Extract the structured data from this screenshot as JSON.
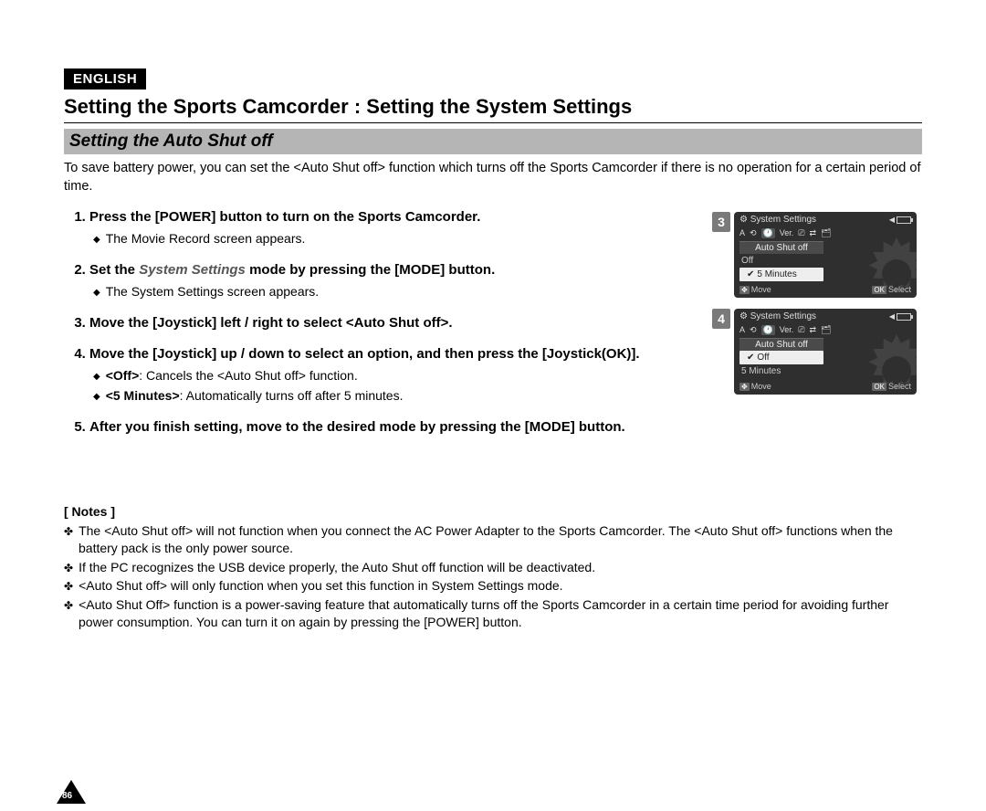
{
  "lang": "ENGLISH",
  "title": "Setting the Sports Camcorder : Setting the System Settings",
  "section": "Setting the Auto Shut off",
  "intro": "To save battery power, you can set the <Auto Shut off> function which turns off the Sports Camcorder if there is no operation for a certain period of time.",
  "steps": {
    "s1": {
      "text": "Press the [POWER] button to turn on the Sports Camcorder.",
      "sub1": "The Movie Record screen appears."
    },
    "s2": {
      "pre": "Set the ",
      "em": "System Settings",
      "post": " mode by pressing the [MODE] button.",
      "sub1": "The System Settings screen appears."
    },
    "s3": {
      "text": "Move the [Joystick] left / right to select <Auto Shut off>."
    },
    "s4": {
      "text": "Move the [Joystick] up / down to select an option, and then press the [Joystick(OK)].",
      "sub1_b": "<Off>",
      "sub1_r": ": Cancels the <Auto Shut off> function.",
      "sub2_b": "<5 Minutes>",
      "sub2_r": ": Automatically turns off after 5 minutes."
    },
    "s5": {
      "text": "After you finish setting, move to the desired mode by pressing the [MODE] button."
    }
  },
  "notes_header": "[ Notes ]",
  "notes": {
    "n1": "The <Auto Shut off> will not function when you connect the AC Power Adapter to the Sports Camcorder. The <Auto Shut off> functions when the battery pack is the only power source.",
    "n2": "If the PC recognizes the USB device properly, the Auto Shut off function will be deactivated.",
    "n3": "<Auto Shut off> will only function when you set this function in System Settings mode.",
    "n4": "<Auto Shut Off> function is a power-saving feature that automatically turns off the Sports Camcorder in a certain time period for avoiding further power consumption. You can turn it on again by pressing the [POWER] button."
  },
  "page_number": "86",
  "lcd": {
    "title": "System Settings",
    "menu": "Auto Shut off",
    "opt_off": "Off",
    "opt_5min": "5 Minutes",
    "move": "Move",
    "select": "Select",
    "step3": "3",
    "step4": "4"
  }
}
